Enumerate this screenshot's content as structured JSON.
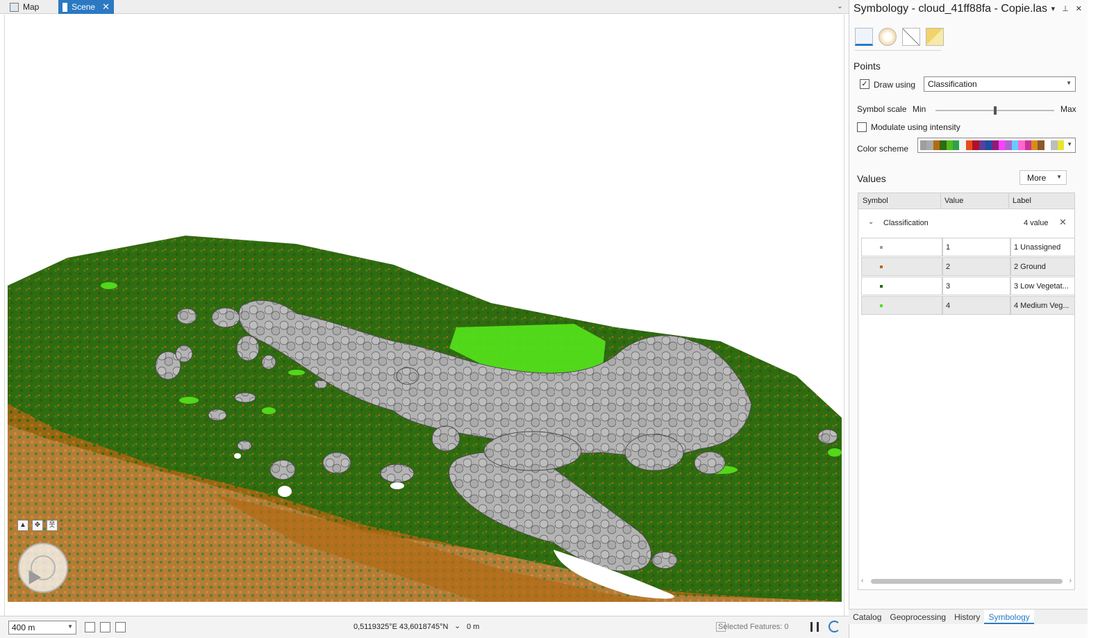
{
  "tabs": {
    "map_label": "Map",
    "scene_label": "Scene"
  },
  "status": {
    "scale": "400 m",
    "coordinates": "0,5119325°E 43,6018745°N",
    "elevation": "0 m",
    "selected_features": "Selected Features: 0"
  },
  "pane": {
    "title": "Symbology - cloud_41ff88fa - Copie.las",
    "points_heading": "Points",
    "draw_using_label": "Draw using",
    "draw_using_checked": true,
    "draw_using_value": "Classification",
    "symbol_scale_label": "Symbol scale",
    "scale_min": "Min",
    "scale_max": "Max",
    "symbol_scale_level": 0.5,
    "modulate_label": "Modulate using intensity",
    "modulate_checked": false,
    "color_scheme_label": "Color scheme",
    "color_scheme_colors": [
      "#9e9e9e",
      "#a9a9a9",
      "#b26b12",
      "#2f6b10",
      "#52b91f",
      "#2ea24a",
      "#f2f2f2",
      "#e84b1b",
      "#b0102a",
      "#5a3f9a",
      "#1d4fa3",
      "#8b1e79",
      "#ff3fff",
      "#aa66cc",
      "#66ccff",
      "#ff66cc",
      "#cc3399",
      "#d98c19",
      "#8a5a2b",
      "#ffffff",
      "#bdbdbd",
      "#e6e62e"
    ],
    "values_heading": "Values",
    "more_label": "More",
    "table": {
      "col_symbol": "Symbol",
      "col_value": "Value",
      "col_label": "Label",
      "group_name": "Classification",
      "group_count": "4 value",
      "rows": [
        {
          "value": "1",
          "label": "1  Unassigned",
          "color": "#9e9e9e"
        },
        {
          "value": "2",
          "label": "2  Ground",
          "color": "#b26b12"
        },
        {
          "value": "3",
          "label": "3  Low Vegetat...",
          "color": "#2f6b10"
        },
        {
          "value": "4",
          "label": "4  Medium Veg...",
          "color": "#52e01f"
        }
      ]
    },
    "bottom_tabs": [
      "Catalog",
      "Geoprocessing",
      "History",
      "Symbology"
    ],
    "active_bottom_tab": "Symbology"
  },
  "icons": {
    "map_tab": "map-icon",
    "scene_tab": "scene-icon",
    "close": "close-icon",
    "navigator": "navigator-icon",
    "refresh": "refresh-icon",
    "pause": "pause-icon"
  }
}
